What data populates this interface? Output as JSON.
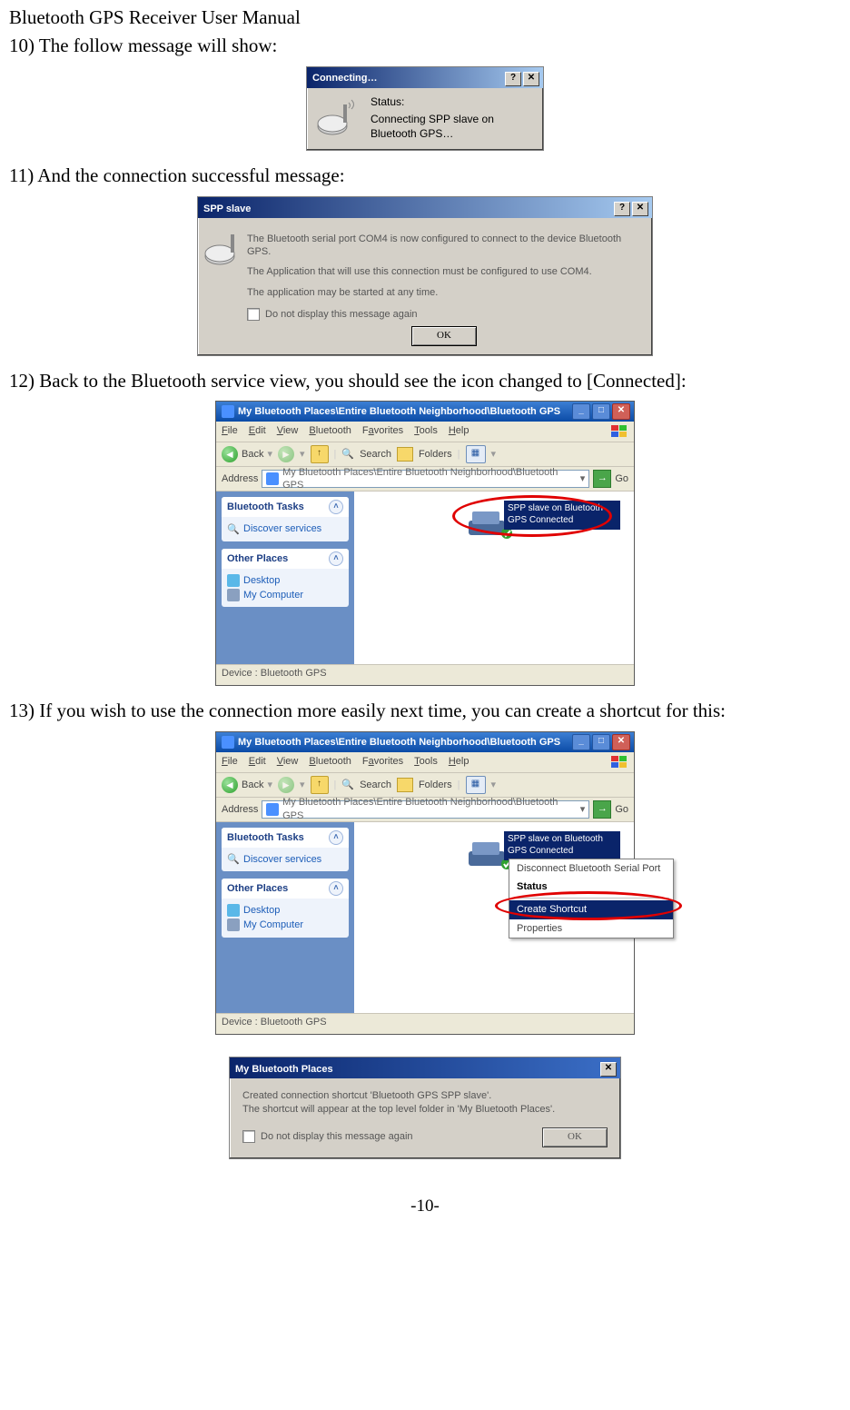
{
  "doc": {
    "header": "Bluetooth GPS Receiver User Manual",
    "step10": "10) The follow message will show:",
    "step11": "11) And the connection successful message:",
    "step12": "12) Back to the Bluetooth service view, you should see the icon changed to [Connected]:",
    "step13": "13) If you wish to use the connection more easily next time, you can create a shortcut for this:",
    "page_no": "-10-"
  },
  "dlg_connecting": {
    "title": "Connecting…",
    "help_btn": "?",
    "close_btn": "✕",
    "status_label": "Status:",
    "status_text": "Connecting SPP slave on Bluetooth GPS…"
  },
  "dlg_spp": {
    "title": "SPP slave",
    "help_btn": "?",
    "close_btn": "✕",
    "line1": "The Bluetooth serial port COM4 is now configured to connect to the device Bluetooth GPS.",
    "line2": "The Application that will use this connection must be configured to use COM4.",
    "line3": "The application may be started at any time.",
    "checkbox": "Do not display this message again",
    "ok": "OK"
  },
  "explorer1": {
    "title": "My Bluetooth Places\\Entire Bluetooth Neighborhood\\Bluetooth GPS",
    "min": "_",
    "max": "□",
    "close": "✕",
    "menu": {
      "file": "File",
      "edit": "Edit",
      "view": "View",
      "bluetooth": "Bluetooth",
      "fav": "Favorites",
      "tools": "Tools",
      "help": "Help"
    },
    "toolbar": {
      "back": "Back",
      "search": "Search",
      "folders": "Folders"
    },
    "address_label": "Address",
    "address_value": "My Bluetooth Places\\Entire Bluetooth Neighborhood\\Bluetooth GPS",
    "go": "Go",
    "sidebar": {
      "tasks_title": "Bluetooth Tasks",
      "discover": "Discover services",
      "other_title": "Other Places",
      "desktop": "Desktop",
      "mycomputer": "My Computer"
    },
    "device_label": "SPP slave on Bluetooth GPS Connected",
    "status": "Device : Bluetooth GPS"
  },
  "explorer2": {
    "title": "My Bluetooth Places\\Entire Bluetooth Neighborhood\\Bluetooth GPS",
    "min": "_",
    "max": "□",
    "close": "✕",
    "menu": {
      "file": "File",
      "edit": "Edit",
      "view": "View",
      "bluetooth": "Bluetooth",
      "fav": "Favorites",
      "tools": "Tools",
      "help": "Help"
    },
    "toolbar": {
      "back": "Back",
      "search": "Search",
      "folders": "Folders"
    },
    "address_label": "Address",
    "address_value": "My Bluetooth Places\\Entire Bluetooth Neighborhood\\Bluetooth GPS",
    "go": "Go",
    "sidebar": {
      "tasks_title": "Bluetooth Tasks",
      "discover": "Discover services",
      "other_title": "Other Places",
      "desktop": "Desktop",
      "mycomputer": "My Computer"
    },
    "device_label": "SPP slave on Bluetooth GPS Connected",
    "status": "Device : Bluetooth GPS",
    "context_menu": {
      "disconnect": "Disconnect Bluetooth Serial Port",
      "status_item": "Status",
      "create_shortcut": "Create Shortcut",
      "properties": "Properties"
    }
  },
  "dlg_info": {
    "title": "My Bluetooth Places",
    "close_btn": "✕",
    "line1": "Created connection shortcut 'Bluetooth GPS SPP slave'.",
    "line2": "The shortcut will appear at the top level folder in 'My Bluetooth Places'.",
    "checkbox": "Do not display this message again",
    "ok": "OK"
  }
}
